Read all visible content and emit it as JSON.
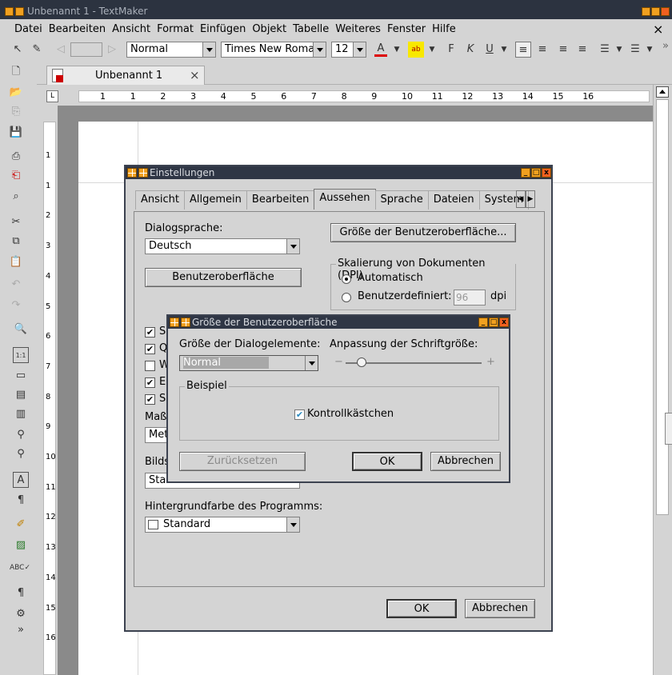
{
  "app": {
    "title": "Unbenannt 1 - TextMaker",
    "close_glyph": "×"
  },
  "menu": [
    "Datei",
    "Bearbeiten",
    "Ansicht",
    "Format",
    "Einfügen",
    "Objekt",
    "Tabelle",
    "Weiteres",
    "Fenster",
    "Hilfe"
  ],
  "toolbar": {
    "style": "Normal",
    "font": "Times New Roman",
    "size": "12",
    "bold": "F",
    "italic": "K",
    "underline": "U",
    "more": "»"
  },
  "doc_tab": {
    "label": "Unbenannt 1",
    "close": "×"
  },
  "ruler": {
    "h_numbers": [
      "1",
      "1",
      "2",
      "3",
      "4",
      "5",
      "6",
      "7",
      "8",
      "9",
      "10",
      "11",
      "12",
      "13",
      "14",
      "15",
      "16"
    ],
    "v_numbers": [
      "1",
      "1",
      "2",
      "3",
      "4",
      "5",
      "6",
      "7",
      "8",
      "9",
      "10",
      "11",
      "12",
      "13",
      "14",
      "15",
      "16"
    ]
  },
  "settings": {
    "title": "Einstellungen",
    "tabs": [
      "Ansicht",
      "Allgemein",
      "Bearbeiten",
      "Aussehen",
      "Sprache",
      "Dateien",
      "System"
    ],
    "selected_tab": "Aussehen",
    "dialog_lang_label": "Dialogsprache:",
    "dialog_lang_value": "Deutsch",
    "ui_button": "Benutzeroberfläche",
    "ui_size_button": "Größe der Benutzeroberfläche...",
    "dpi_group": "Skalierung von Dokumenten (DPI)",
    "dpi_auto": "Automatisch",
    "dpi_custom": "Benutzerdefiniert:",
    "dpi_value": "96",
    "dpi_unit": "dpi",
    "partial_checks": [
      "S",
      "Q",
      "W",
      "E",
      "S"
    ],
    "mass_label": "Maße",
    "mass_value": "Metr",
    "bild_label": "Bilds",
    "bild_value": "Stan",
    "bg_label": "Hintergrundfarbe des Programms:",
    "bg_value": "Standard",
    "ok": "OK",
    "cancel": "Abbrechen"
  },
  "uisize": {
    "title": "Größe der Benutzeroberfläche",
    "elem_label": "Größe der Dialogelemente:",
    "elem_value": "Normal",
    "font_label": "Anpassung der Schriftgröße:",
    "minus": "−",
    "plus": "+",
    "example_group": "Beispiel",
    "checkbox_label": "Kontrollkästchen",
    "reset": "Zurücksetzen",
    "ok": "OK",
    "cancel": "Abbrechen"
  }
}
